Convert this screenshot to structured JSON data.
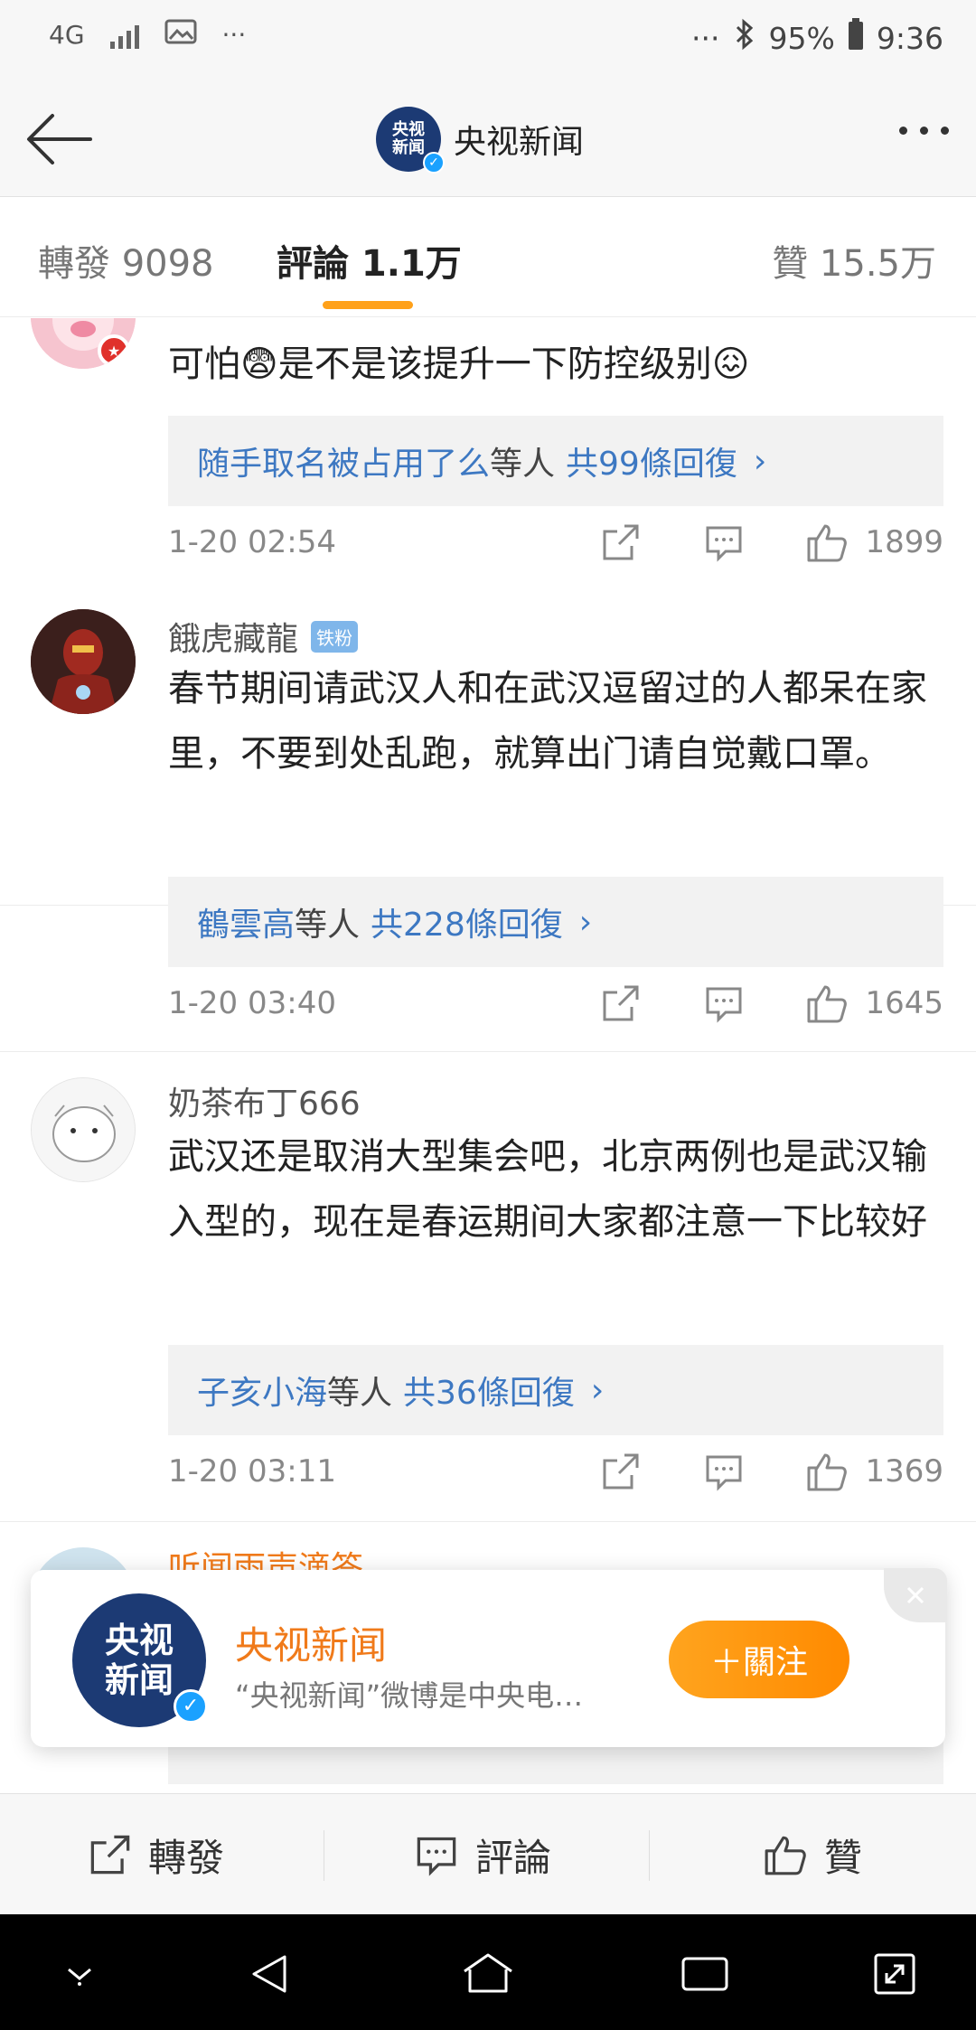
{
  "status_bar": {
    "network": "4G",
    "more": "···",
    "more_right": "···",
    "battery": "95%",
    "time": "9:36"
  },
  "header": {
    "account_name": "央视新闻",
    "logo_top": "央视",
    "logo_bottom": "新闻",
    "verified_mark": "✓"
  },
  "tabs": [
    {
      "label": "轉發 9098"
    },
    {
      "label": "評論 1.1万"
    },
    {
      "label": "贊 15.5万"
    }
  ],
  "colors": {
    "accent": "#ffa11a",
    "link": "#3d78c2",
    "brand_orange": "#f07a1a",
    "logo_blue": "#1c3a74"
  },
  "comments": [
    {
      "user": "",
      "text": "可怕😨是不是该提升一下防控级别😖",
      "replies": {
        "names": "随手取名被占用了么",
        "mid": "等人",
        "count": "共99條回復",
        "chevron": "›"
      },
      "time": "1-20 02:54",
      "likes": "1899"
    },
    {
      "user": "餓虎藏龍",
      "badge": "铁粉",
      "text": "春节期间请武汉人和在武汉逗留过的人都呆在家里，不要到处乱跑，就算出门请自觉戴口罩。",
      "replies": {
        "names": "鶴雲高",
        "mid": "等人",
        "count": "共228條回復",
        "chevron": "›"
      },
      "time": "1-20 03:40",
      "likes": "1645"
    },
    {
      "user": "奶茶布丁666",
      "text": "武汉还是取消大型集会吧，北京两例也是武汉输入型的，现在是春运期间大家都注意一下比较好",
      "replies": {
        "names": "子亥小海",
        "mid": "等人",
        "count": "共36條回復",
        "chevron": "›"
      },
      "time": "1-20 03:11",
      "likes": "1369"
    },
    {
      "user": "听闻雨声滴答"
    }
  ],
  "follow_card": {
    "name": "央视新闻",
    "description": "“央视新闻”微博是中央电…",
    "follow_label": "＋關注",
    "logo_top": "央视",
    "logo_bottom": "新闻"
  },
  "action_bar": {
    "repost": "轉發",
    "comment": "評論",
    "like": "贊"
  },
  "icons": [
    "back-arrow-icon",
    "more-dots-icon",
    "share-icon",
    "comment-icon",
    "thumbs-up-icon",
    "close-icon",
    "bluetooth-icon",
    "battery-icon"
  ]
}
